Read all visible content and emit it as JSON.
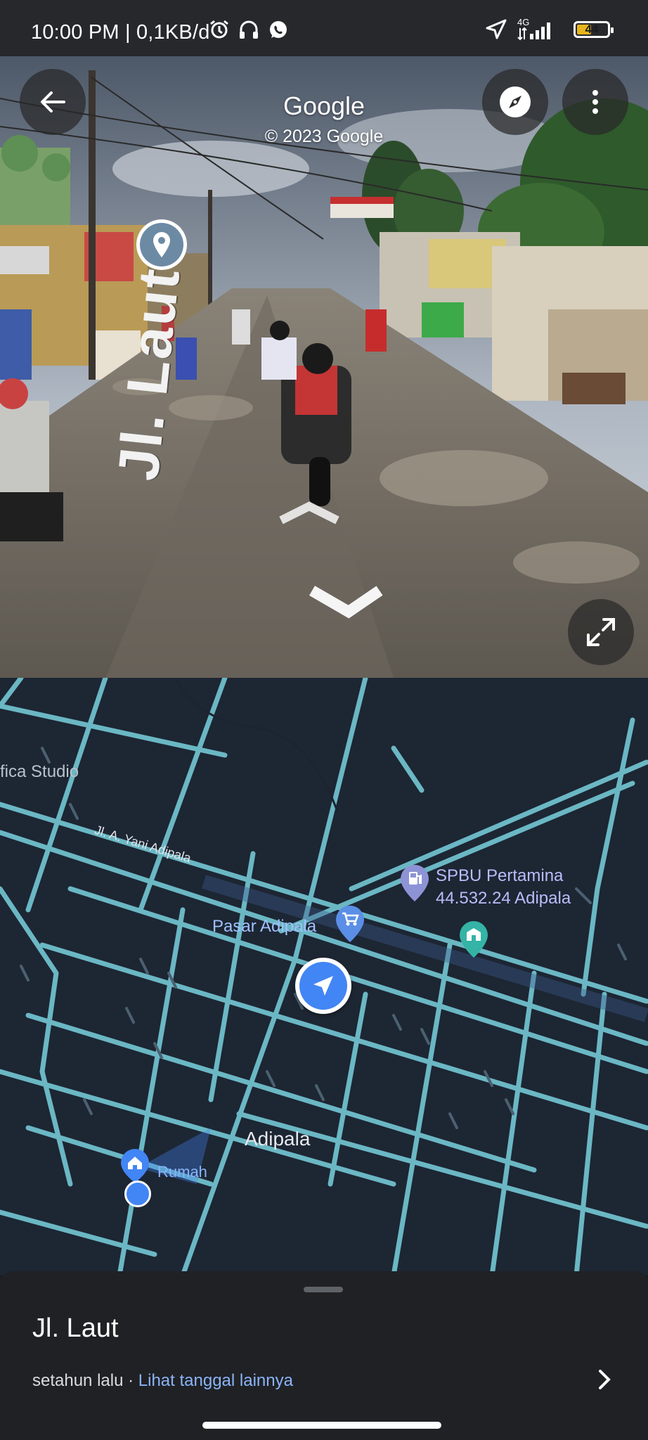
{
  "status_bar": {
    "time": "10:00 PM | 0,1KB/d",
    "network": "4G",
    "battery": "44"
  },
  "street_view": {
    "brand": "Google",
    "copyright": "© 2023 Google",
    "street_label": "Jl. Laut",
    "icons": [
      "back-arrow-icon",
      "compass-icon",
      "more-vert-icon",
      "location-pin-icon",
      "expand-icon",
      "navigate-chevron-icon"
    ]
  },
  "map": {
    "labels": {
      "studio": "fica Studio",
      "road": "Jl. A. Yani Adipala",
      "gas_station_name": "SPBU Pertamina",
      "gas_station_detail": "44.532.24 Adipala",
      "market": "Pasar Adipala",
      "town": "Adipala",
      "home": "Rumah"
    },
    "colors": {
      "road": "#6bb7c4",
      "background": "#1d2633",
      "my_location": "#4285f4"
    }
  },
  "sheet": {
    "title": "Jl. Laut",
    "time_ago": "setahun lalu",
    "separator": " · ",
    "link": "Lihat tanggal lainnya"
  }
}
